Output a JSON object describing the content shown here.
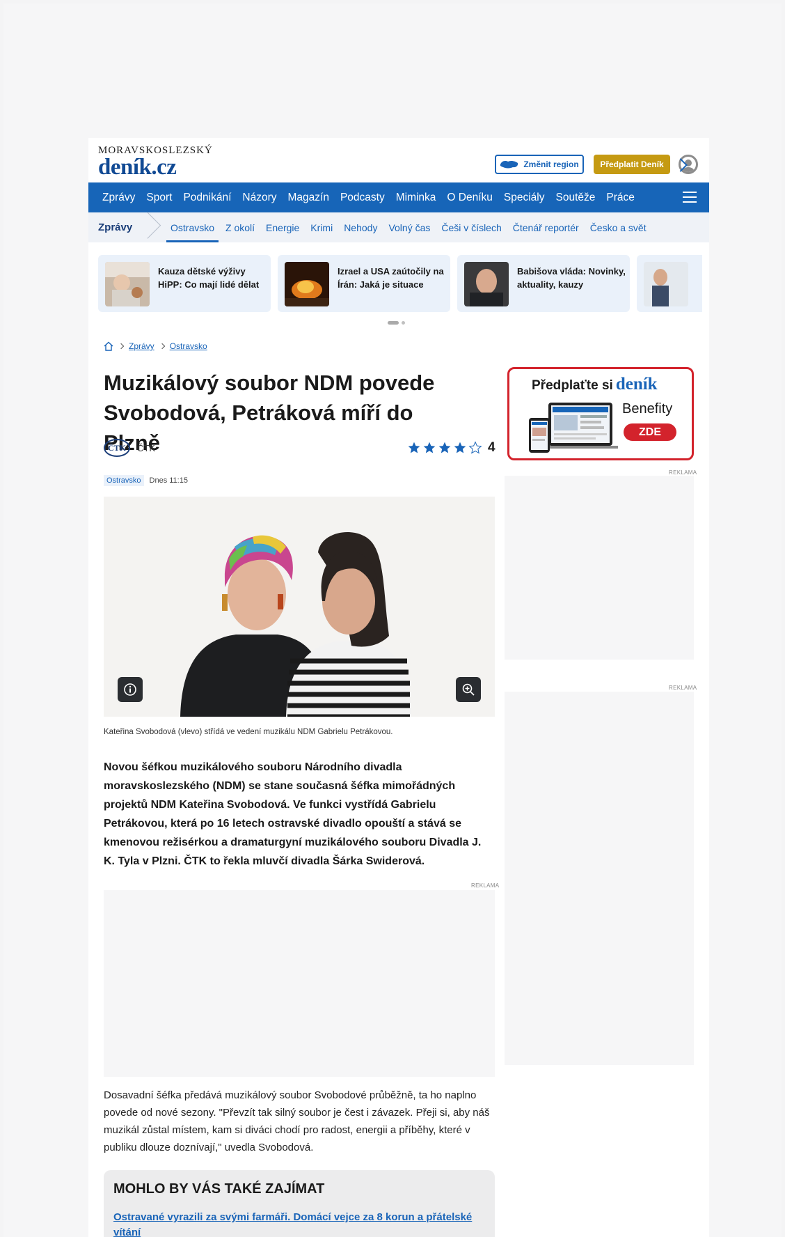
{
  "header": {
    "brand_top": "MORAVSKOSLEZSKÝ",
    "brand_main": "deník.cz",
    "region_button": "Změnit region",
    "subscribe_button": "Předplatit Deník"
  },
  "main_nav": [
    "Zprávy",
    "Sport",
    "Podnikání",
    "Názory",
    "Magazín",
    "Podcasty",
    "Miminka",
    "O Deníku",
    "Speciály",
    "Soutěže",
    "Práce"
  ],
  "sub_nav": {
    "section": "Zprávy",
    "items": [
      "Ostravsko",
      "Z okolí",
      "Energie",
      "Krimi",
      "Nehody",
      "Volný čas",
      "Češi v číslech",
      "Čtenář reportér",
      "Česko a svět"
    ]
  },
  "teasers": [
    {
      "title": "Kauza dětské výživy HiPP: Co mají lidé dělat"
    },
    {
      "title": "Izrael a USA zaútočily na Írán: Jaká je situace"
    },
    {
      "title": "Babišova vláda: Novinky, aktuality, kauzy"
    }
  ],
  "breadcrumb": [
    "Zprávy",
    "Ostravsko"
  ],
  "article": {
    "title": "Muzikálový soubor NDM povede Svobodová, Petráková míří do Plzně",
    "agency_logo": "ČTK",
    "agency": "ČTK",
    "rating": 4,
    "rating_label": "4",
    "tag": "Ostravsko",
    "time": "Dnes 11:15",
    "caption": "Kateřina Svobodová (vlevo) střídá ve vedení muzikálu NDM Gabrielu Petrákovou.",
    "perex": "Novou šéfkou muzikálového souboru Národního divadla moravskoslezského (NDM) se stane současná šéfka mimořádných projektů NDM Kateřina Svobodová. Ve funkci vystřídá Gabrielu Petrákovou, která po 16 letech ostravské divadlo opouští a stává se kmenovou režisérkou a dramaturgyní muzikálového souboru Divadla J. K. Tyla v Plzni. ČTK to řekla mluvčí divadla Šárka Swiderová.",
    "paragraph": "Dosavadní šéfka předává muzikálový soubor Svobodové průběžně, ta ho naplno povede od nové sezony. \"Převzít tak silný soubor je čest i závazek. Přeji si, aby náš muzikál zůstal místem, kam si diváci chodí pro radost, energii a příběhy, které v publiku dlouze doznívají,\" uvedla Svobodová."
  },
  "ads": {
    "label": "REKLAMA"
  },
  "related": {
    "heading": "MOHLO BY VÁS TAKÉ ZAJÍMAT",
    "link": "Ostravané vyrazili za svými farmáři. Domácí vejce za 8 korun a přátelské vítání"
  },
  "promo": {
    "text": "Předplaťte si",
    "brand": "deník",
    "benefits": "Benefity",
    "cta": "ZDE"
  },
  "colors": {
    "brand_blue": "#1765b8",
    "gold": "#c59a12",
    "promo_red": "#d3232c"
  },
  "icons": [
    "region-map-icon",
    "user-avatar-icon",
    "menu-icon",
    "home-icon",
    "info-icon",
    "zoom-icon",
    "star-icon",
    "chevron-right-icon"
  ]
}
